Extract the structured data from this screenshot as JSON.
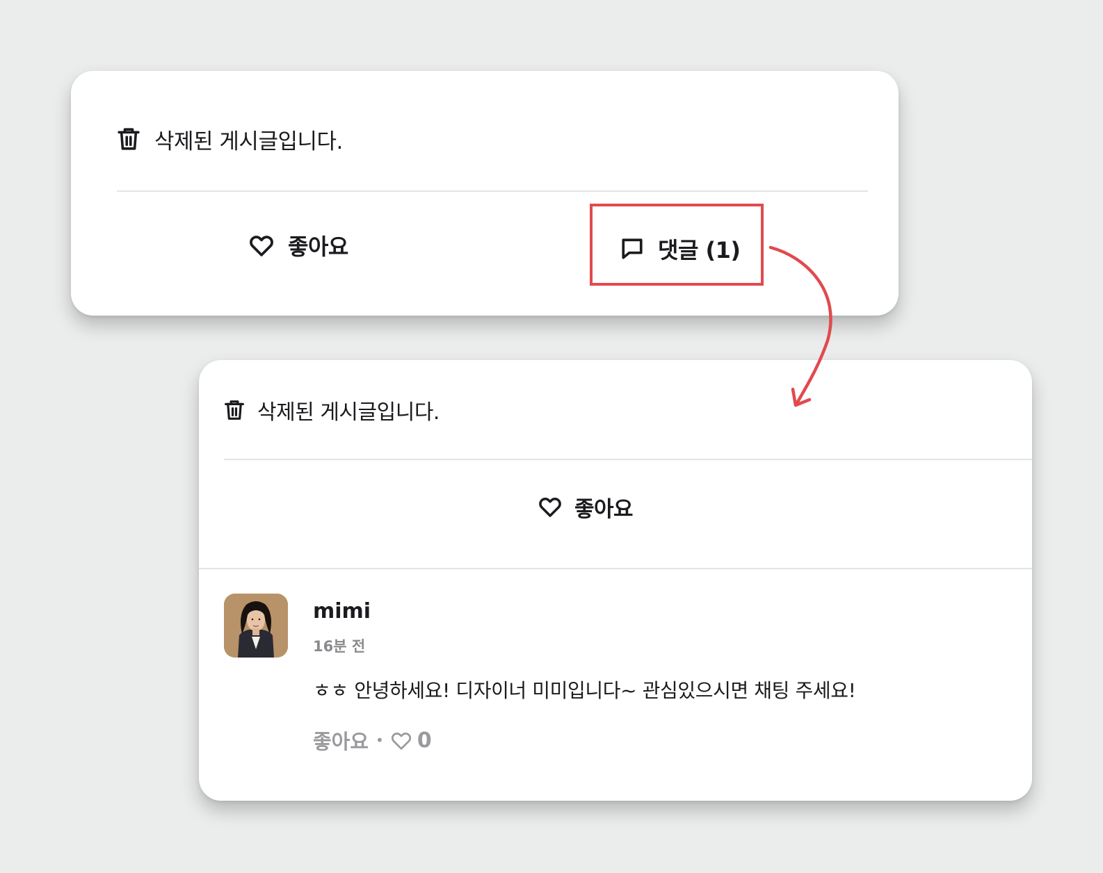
{
  "top_card": {
    "deleted_message": "삭제된 게시글입니다.",
    "like_label": "좋아요",
    "comment_label": "댓글 (1)"
  },
  "bottom_card": {
    "deleted_message": "삭제된 게시글입니다.",
    "like_label": "좋아요",
    "comment": {
      "author": "mimi",
      "time": "16분 전",
      "text": "ㅎㅎ 안녕하세요! 디자이너 미미입니다~ 관심있으시면 채팅 주세요!",
      "like_label": "좋아요",
      "separator": "•",
      "like_count": "0"
    }
  },
  "colors": {
    "highlight": "#e04a4f",
    "background": "#ebecec",
    "muted_text": "#9a9a9e"
  },
  "icons": [
    "trash-icon",
    "heart-icon",
    "comment-bubble-icon",
    "arrow-icon"
  ]
}
